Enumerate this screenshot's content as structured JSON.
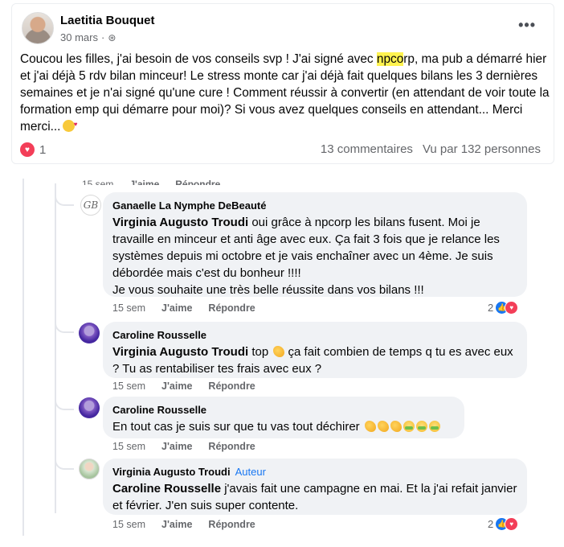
{
  "post": {
    "author": "Laetitia Bouquet",
    "date": "30 mars",
    "dot": "·",
    "audience_icon": "globe-icon",
    "more_icon": "•••",
    "text_before": "Coucou les filles, j'ai besoin de vos conseils svp ! J'ai signé avec ",
    "text_highlight": "npco",
    "text_after": "rp, ma pub a démarré hier et j'ai déjà 5 rdv bilan minceur! Le stress monte car j'ai déjà fait quelques bilans les 3 dernières semaines et je n'ai signé qu'une cure ! Comment réussir à convertir (en attendant de voir toute la formation emp qui démarre pour moi)? Si vous avez quelques conseils en attendant... Merci merci...",
    "reaction_count": "1",
    "comments_count": "13 commentaires",
    "views": "Vu par 132 personnes"
  },
  "top_cut": {
    "time": "15 sem",
    "like": "J'aime",
    "reply": "Répondre"
  },
  "comments": [
    {
      "author": "Ganaelle La Nymphe DeBeauté",
      "mention": "Virginia Augusto Troudi",
      "text": " oui grâce à npcorp les bilans fusent. Moi je travaille en minceur et anti âge avec eux. Ça fait 3 fois que je relance les systèmes depuis mi octobre et je vais enchaîner avec un 4ème. Je suis débordée mais c'est du bonheur !!!!",
      "text2": "Je vous souhaite une très belle réussite dans vos bilans !!!",
      "time": "15 sem",
      "like": "J'aime",
      "reply": "Répondre",
      "reactions": "2"
    },
    {
      "author": "Caroline Rousselle",
      "mention": "Virginia Augusto Troudi",
      "text_a": " top ",
      "text_b": " ça fait combien de temps q tu es avec eux ? Tu as rentabiliser tes frais avec eux ?",
      "time": "15 sem",
      "like": "J'aime",
      "reply": "Répondre"
    },
    {
      "author": "Caroline Rousselle",
      "text": "En tout cas je suis sur que tu vas tout déchirer ",
      "time": "15 sem",
      "like": "J'aime",
      "reply": "Répondre"
    },
    {
      "author": "Virginia Augusto Troudi",
      "badge": "Auteur",
      "mention": "Caroline Rousselle",
      "text": " j'avais fait une campagne en mai. Et la j'ai refait janvier et février. J'en suis super contente.",
      "time": "15 sem",
      "like": "J'aime",
      "reply": "Répondre",
      "reactions": "2"
    }
  ],
  "colors": {
    "like": "#1877f2",
    "love": "#f33e58",
    "highlight": "#fff34f",
    "bubble": "#f0f2f5"
  }
}
